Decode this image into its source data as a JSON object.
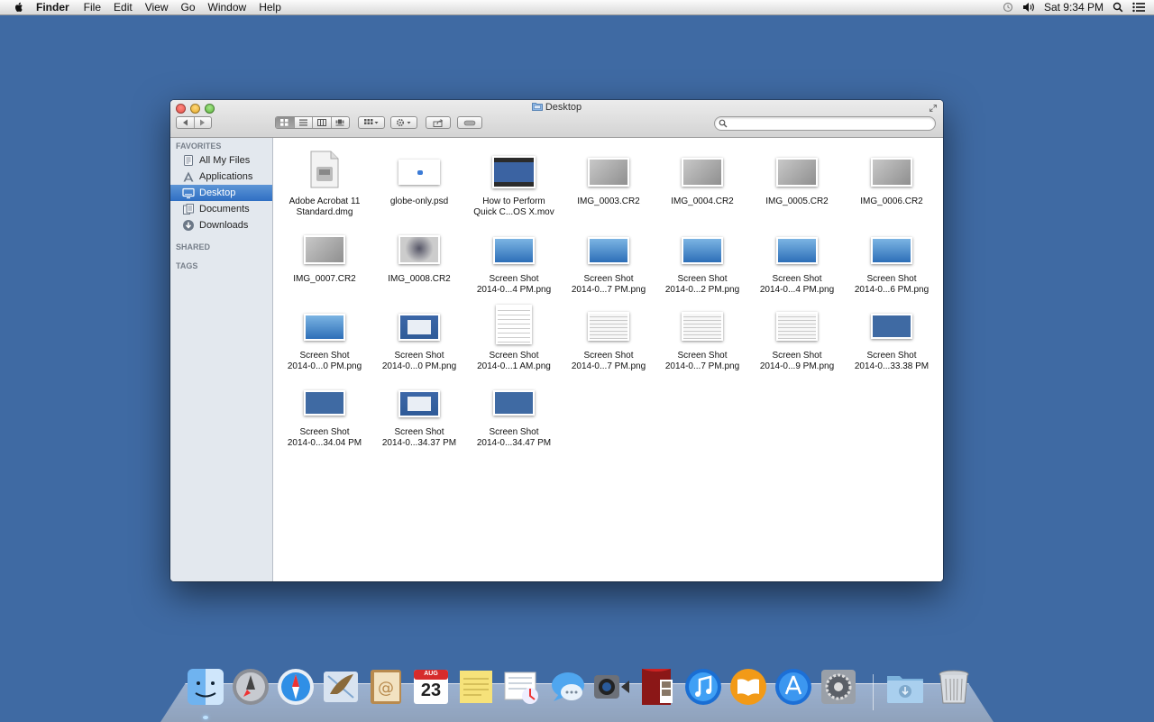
{
  "menubar": {
    "app": "Finder",
    "items": [
      "File",
      "Edit",
      "View",
      "Go",
      "Window",
      "Help"
    ],
    "clock": "Sat 9:34 PM"
  },
  "window": {
    "title": "Desktop",
    "search": {
      "value": "",
      "placeholder": ""
    }
  },
  "sidebar": {
    "favorites_header": "FAVORITES",
    "items": [
      "All My Files",
      "Applications",
      "Desktop",
      "Documents",
      "Downloads"
    ],
    "selected": "Desktop",
    "shared_header": "SHARED",
    "tags_header": "TAGS"
  },
  "files": [
    {
      "name": "Adobe Acrobat 11\nStandard.dmg",
      "kind": "dmg-icon"
    },
    {
      "name": "globe-only.psd",
      "kind": "psd-thumb"
    },
    {
      "name": "How to Perform\nQuick C...OS X.mov",
      "kind": "movie-thumb"
    },
    {
      "name": "IMG_0003.CR2",
      "kind": "photo-thumb"
    },
    {
      "name": "IMG_0004.CR2",
      "kind": "photo-thumb"
    },
    {
      "name": "IMG_0005.CR2",
      "kind": "photo-thumb"
    },
    {
      "name": "IMG_0006.CR2",
      "kind": "photo-thumb"
    },
    {
      "name": "IMG_0007.CR2",
      "kind": "photo-thumb"
    },
    {
      "name": "IMG_0008.CR2",
      "kind": "laptop-thumb"
    },
    {
      "name": "Screen Shot\n2014-0...4 PM.png",
      "kind": "screenshot-thumb"
    },
    {
      "name": "Screen Shot\n2014-0...7 PM.png",
      "kind": "screenshot-thumb"
    },
    {
      "name": "Screen Shot\n2014-0...2 PM.png",
      "kind": "screenshot-thumb"
    },
    {
      "name": "Screen Shot\n2014-0...4 PM.png",
      "kind": "screenshot-thumb"
    },
    {
      "name": "Screen Shot\n2014-0...6 PM.png",
      "kind": "screenshot-thumb"
    },
    {
      "name": "Screen Shot\n2014-0...0 PM.png",
      "kind": "screenshot-thumb"
    },
    {
      "name": "Screen Shot\n2014-0...0 PM.png",
      "kind": "window-thumb"
    },
    {
      "name": "Screen Shot\n2014-0...1 AM.png",
      "kind": "doc-thumb"
    },
    {
      "name": "Screen Shot\n2014-0...7 PM.png",
      "kind": "list-thumb"
    },
    {
      "name": "Screen Shot\n2014-0...7 PM.png",
      "kind": "list-thumb"
    },
    {
      "name": "Screen Shot\n2014-0...9 PM.png",
      "kind": "list-thumb"
    },
    {
      "name": "Screen Shot\n2014-0...33.38 PM",
      "kind": "desktop-thumb"
    },
    {
      "name": "Screen Shot\n2014-0...34.04 PM",
      "kind": "desktop-thumb"
    },
    {
      "name": "Screen Shot\n2014-0...34.37 PM",
      "kind": "window-thumb"
    },
    {
      "name": "Screen Shot\n2014-0...34.47 PM",
      "kind": "desktop-thumb"
    }
  ],
  "dock": {
    "apps": [
      "finder",
      "launchpad",
      "safari",
      "mail",
      "contacts",
      "calendar",
      "notes",
      "reminders",
      "messages",
      "facetime",
      "photo-booth",
      "itunes",
      "ibooks",
      "app-store",
      "system-preferences"
    ],
    "calendar_month": "AUG",
    "calendar_day": "23",
    "right_items": [
      "downloads-stack",
      "trash"
    ]
  },
  "colors": {
    "desktop": "#3f6aa3",
    "selection": "#2f6fc3",
    "sidebar": "#e3e8ee"
  }
}
